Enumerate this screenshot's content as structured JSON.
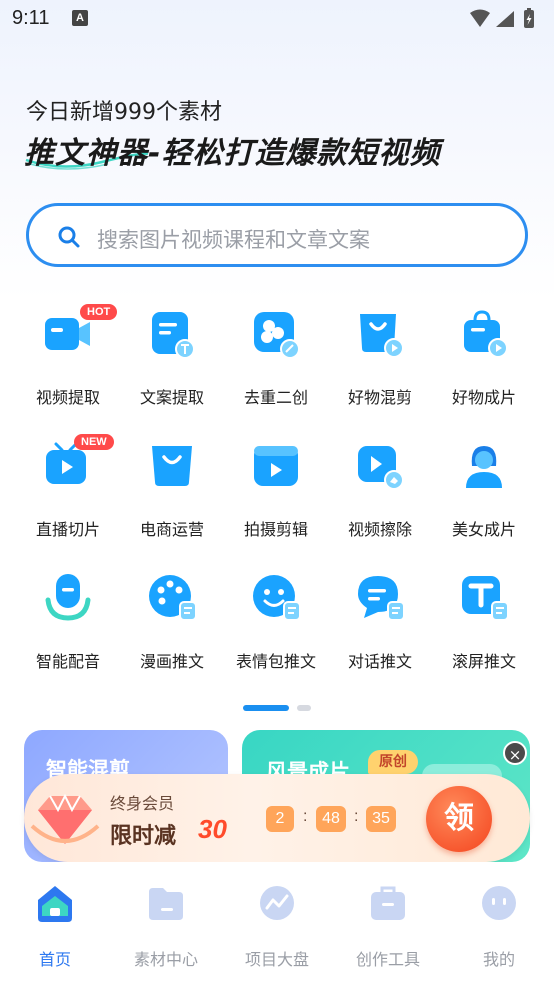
{
  "status_bar": {
    "time": "9:11",
    "notification_letter": "A"
  },
  "header": {
    "headline": "今日新增999个素材",
    "slogan": "推文神器-轻松打造爆款短视频"
  },
  "search": {
    "placeholder": "搜索图片视频课程和文章文案"
  },
  "tools": [
    {
      "label": "视频提取",
      "icon": "video-camera-icon",
      "badge": "HOT"
    },
    {
      "label": "文案提取",
      "icon": "text-extract-icon"
    },
    {
      "label": "去重二创",
      "icon": "dedupe-edit-icon"
    },
    {
      "label": "好物混剪",
      "icon": "shopping-bag-video-icon"
    },
    {
      "label": "好物成片",
      "icon": "bag-video-icon"
    },
    {
      "label": "直播切片",
      "icon": "live-tv-icon",
      "badge": "NEW"
    },
    {
      "label": "电商运营",
      "icon": "ecommerce-bag-icon"
    },
    {
      "label": "拍摄剪辑",
      "icon": "clapper-icon"
    },
    {
      "label": "视频擦除",
      "icon": "video-erase-icon"
    },
    {
      "label": "美女成片",
      "icon": "woman-icon"
    },
    {
      "label": "智能配音",
      "icon": "microphone-icon"
    },
    {
      "label": "漫画推文",
      "icon": "palette-icon"
    },
    {
      "label": "表情包推文",
      "icon": "smiley-icon"
    },
    {
      "label": "对话推文",
      "icon": "chat-bubble-icon"
    },
    {
      "label": "滚屏推文",
      "icon": "text-t-icon"
    }
  ],
  "pager": {
    "pages": 2,
    "active": 1
  },
  "cards": [
    {
      "title": "智能混剪"
    },
    {
      "title": "风景成片",
      "tag": "原创"
    }
  ],
  "promo": {
    "line1": "终身会员",
    "line2": "限时减",
    "discount": "30",
    "countdown": [
      "2",
      "48",
      "35"
    ],
    "separator": ":",
    "claim": "领",
    "close": "×"
  },
  "tabbar": [
    {
      "label": "首页",
      "icon": "home-icon",
      "active": true
    },
    {
      "label": "素材中心",
      "icon": "folder-icon"
    },
    {
      "label": "项目大盘",
      "icon": "trend-icon"
    },
    {
      "label": "创作工具",
      "icon": "toolbox-icon"
    },
    {
      "label": "我的",
      "icon": "profile-icon"
    }
  ],
  "colors": {
    "accent": "#2d8ef0",
    "tab_active": "#2d78f0",
    "icon_blue": "#1aa3ff",
    "promo_red": "#ff4b2b"
  }
}
